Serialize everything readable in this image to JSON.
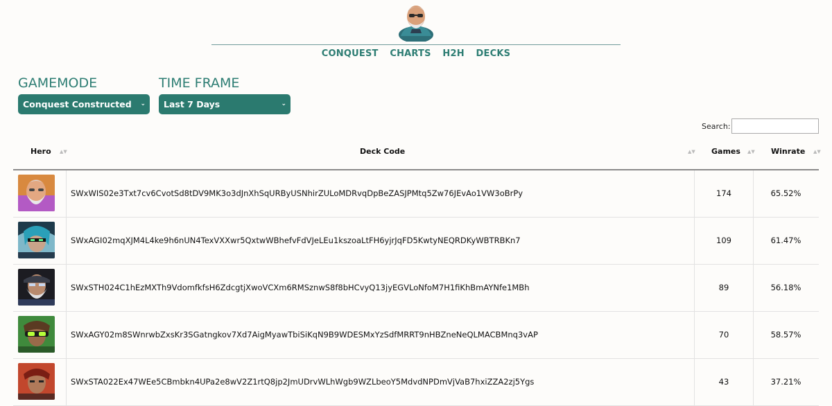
{
  "nav": [
    "CONQUEST",
    "CHARTS",
    "H2H",
    "DECKS"
  ],
  "filters": {
    "gamemode": {
      "label": "GAMEMODE",
      "value": "Conquest Constructed"
    },
    "timeframe": {
      "label": "TIME FRAME",
      "value": "Last 7 Days"
    }
  },
  "search": {
    "label": "Search:",
    "value": ""
  },
  "table": {
    "headers": {
      "hero": "Hero",
      "code": "Deck Code",
      "games": "Games",
      "winrate": "Winrate"
    },
    "rows": [
      {
        "hero_icon": "old-sage-hero-avatar",
        "code": "SWxWIS02e3Txt7cv6CvotSd8tDV9MK3o3dJnXhSqURByUSNhirZULoMDRvqDpBeZASJPMtq5Zw76JEvAo1VW3oBrPy",
        "games": "174",
        "winrate": "65.52%"
      },
      {
        "hero_icon": "cyber-ninja-hero-avatar",
        "code": "SWxAGI02mqXJM4L4ke9h6nUN4TexVXXwr5QxtwWBhefvFdVJeLEu1kszoaLtFH6yjrJqFD5KwtyNEQRDKyWBTRBKn7",
        "games": "109",
        "winrate": "61.47%"
      },
      {
        "hero_icon": "dark-sage-hero-avatar",
        "code": "SWxSTH024C1hEzMXTh9VdomfkfsH6ZdcgtjXwoVCXm6RMSznwS8f8bHCvyQ13jyEGVLoNfoM7H1fiKhBmAYNfe1MBh",
        "games": "89",
        "winrate": "56.18%"
      },
      {
        "hero_icon": "goggles-hero-avatar",
        "code": "SWxAGY02m8SWnrwbZxsKr3SGatngkov7Xd7AigMyawTbiSiKqN9B9WDESMxYzSdfMRRT9nHBZneNeQLMACBMnq3vAP",
        "games": "70",
        "winrate": "58.57%"
      },
      {
        "hero_icon": "red-warrior-hero-avatar",
        "code": "SWxSTA022Ex47WEe5CBmbkn4UPa2e8wV2Z1rtQ8jp2JmUDrvWLhWgb9WZLbeoY5MdvdNPDmVjVaB7hxiZZA2zj5Ygs",
        "games": "43",
        "winrate": "37.21%"
      }
    ]
  }
}
